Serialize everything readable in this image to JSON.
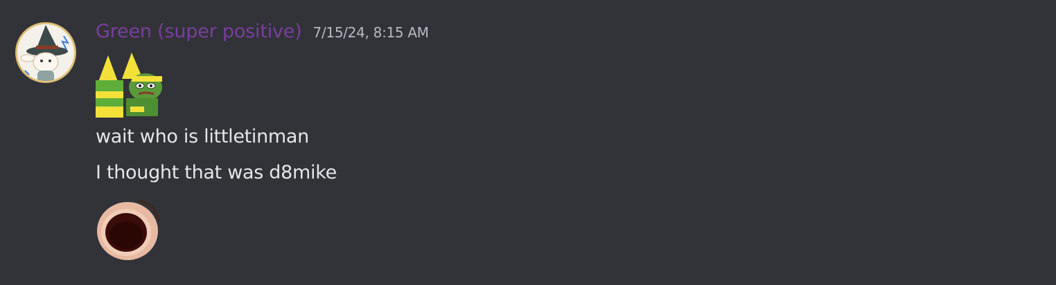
{
  "message": {
    "author": {
      "name": "Green (super positive)",
      "name_color": "#7a3e9d",
      "avatar": "wizard-cat-avatar-icon"
    },
    "timestamp": "7/15/24, 8:15 AM",
    "lines": [
      {
        "type": "emoji",
        "icon": "yellow-hat-pepe-emoji-icon"
      },
      {
        "type": "text",
        "text": "wait who is littletinman"
      },
      {
        "type": "text",
        "text": "I thought that was d8mike"
      },
      {
        "type": "emoji",
        "icon": "screaming-face-emoji-icon"
      }
    ]
  },
  "colors": {
    "background": "#313338",
    "text": "#dbdee1",
    "timestamp": "#b5bac1"
  }
}
